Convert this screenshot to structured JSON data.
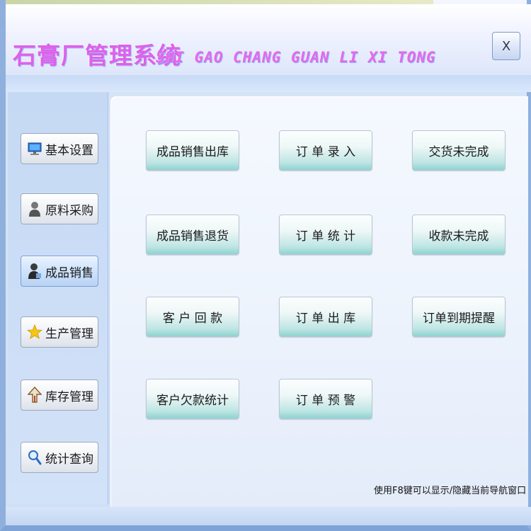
{
  "window": {
    "title_cn": "石膏厂管理系统",
    "title_en": "SHI GAO CHANG GUAN LI XI TONG",
    "close_label": "X"
  },
  "sidebar": {
    "items": [
      {
        "label": "基本设置",
        "icon": "monitor-icon",
        "active": false
      },
      {
        "label": "原料采购",
        "icon": "user-icon",
        "active": false
      },
      {
        "label": "成品销售",
        "icon": "salesperson-icon",
        "active": true
      },
      {
        "label": "生产管理",
        "icon": "star-icon",
        "active": false
      },
      {
        "label": "库存管理",
        "icon": "up-arrow-icon",
        "active": false
      },
      {
        "label": "统计查询",
        "icon": "magnifier-icon",
        "active": false
      }
    ]
  },
  "main": {
    "buttons": [
      {
        "label": "成品销售出库"
      },
      {
        "label": "订 单 录 入"
      },
      {
        "label": "交货未完成"
      },
      {
        "label": "成品销售退货"
      },
      {
        "label": "订 单 统 计"
      },
      {
        "label": "收款未完成"
      },
      {
        "label": "客 户 回 款"
      },
      {
        "label": "订 单 出 库"
      },
      {
        "label": "订单到期提醒"
      },
      {
        "label": "客户欠款统计"
      },
      {
        "label": "订 单 预 警"
      }
    ],
    "hint": "使用F8键可以显示/隐藏当前导航窗口"
  },
  "colors": {
    "title": "#e060e8",
    "button_teal": "#8fd3d0",
    "panel_blue": "#c5d9f4"
  }
}
